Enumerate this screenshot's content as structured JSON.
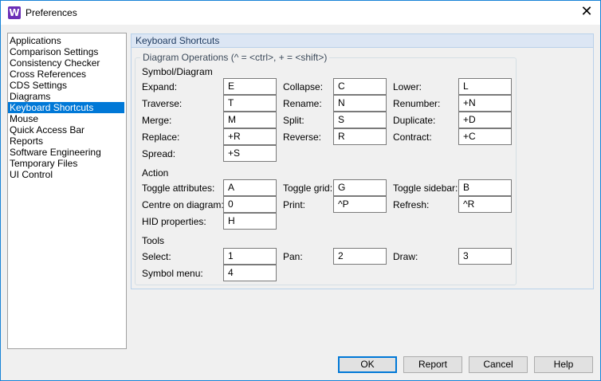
{
  "window": {
    "title": "Preferences",
    "icon_letter": "W",
    "close_symbol": "✕"
  },
  "nav": {
    "items": [
      {
        "label": "Applications"
      },
      {
        "label": "Comparison Settings"
      },
      {
        "label": "Consistency Checker"
      },
      {
        "label": "Cross References"
      },
      {
        "label": "CDS Settings"
      },
      {
        "label": "Diagrams"
      },
      {
        "label": "Keyboard Shortcuts"
      },
      {
        "label": "Mouse"
      },
      {
        "label": "Quick Access Bar"
      },
      {
        "label": "Reports"
      },
      {
        "label": "Software Engineering"
      },
      {
        "label": "Temporary Files"
      },
      {
        "label": "UI Control"
      }
    ],
    "selected": "Keyboard Shortcuts"
  },
  "panel": {
    "header": "Keyboard Shortcuts",
    "frame_title": "Diagram Operations (^ = <ctrl>, + = <shift>)",
    "sections": {
      "symbol": "Symbol/Diagram",
      "action": "Action",
      "tools": "Tools"
    },
    "shortcuts": {
      "expand": {
        "label": "Expand:",
        "value": "E"
      },
      "collapse": {
        "label": "Collapse:",
        "value": "C"
      },
      "lower": {
        "label": "Lower:",
        "value": "L"
      },
      "traverse": {
        "label": "Traverse:",
        "value": "T"
      },
      "rename": {
        "label": "Rename:",
        "value": "N"
      },
      "renumber": {
        "label": "Renumber:",
        "value": "+N"
      },
      "merge": {
        "label": "Merge:",
        "value": "M"
      },
      "split": {
        "label": "Split:",
        "value": "S"
      },
      "duplicate": {
        "label": "Duplicate:",
        "value": "+D"
      },
      "replace": {
        "label": "Replace:",
        "value": "+R"
      },
      "reverse": {
        "label": "Reverse:",
        "value": "R"
      },
      "contract": {
        "label": "Contract:",
        "value": "+C"
      },
      "spread": {
        "label": "Spread:",
        "value": "+S"
      },
      "toggle_attributes": {
        "label": "Toggle attributes:",
        "value": "A"
      },
      "toggle_grid": {
        "label": "Toggle grid:",
        "value": "G"
      },
      "toggle_sidebar": {
        "label": "Toggle sidebar:",
        "value": "B"
      },
      "centre_on_diagram": {
        "label": "Centre on diagram:",
        "value": "0"
      },
      "print": {
        "label": "Print:",
        "value": "^P"
      },
      "refresh": {
        "label": "Refresh:",
        "value": "^R"
      },
      "hid_properties": {
        "label": "HID properties:",
        "value": "H"
      },
      "select": {
        "label": "Select:",
        "value": "1"
      },
      "pan": {
        "label": "Pan:",
        "value": "2"
      },
      "draw": {
        "label": "Draw:",
        "value": "3"
      },
      "symbol_menu": {
        "label": "Symbol menu:",
        "value": "4"
      }
    }
  },
  "buttons": {
    "ok": "OK",
    "report": "Report",
    "cancel": "Cancel",
    "help": "Help"
  }
}
